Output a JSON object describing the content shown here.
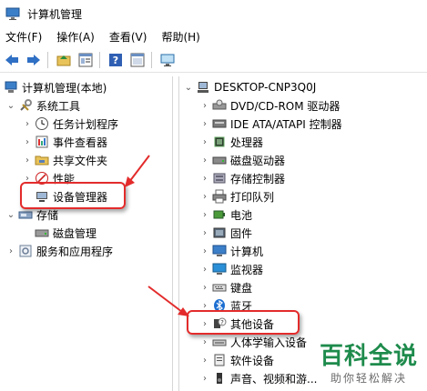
{
  "window": {
    "title": "计算机管理"
  },
  "menu": [
    "文件(F)",
    "操作(A)",
    "查看(V)",
    "帮助(H)"
  ],
  "toolbar": {
    "back_icon": "back-arrow-icon",
    "forward_icon": "forward-arrow-icon",
    "buttons": [
      "up-folder-icon",
      "properties-icon",
      "help-icon",
      "show-hide-icon",
      "monitor-icon"
    ]
  },
  "left_tree": {
    "root": "计算机管理(本地)",
    "system_tools": "系统工具",
    "task_scheduler": "任务计划程序",
    "event_viewer": "事件查看器",
    "shared_folders": "共享文件夹",
    "performance": "性能",
    "device_manager": "设备管理器",
    "storage": "存储",
    "disk_management": "磁盘管理",
    "services_apps": "服务和应用程序"
  },
  "right_tree": {
    "computer": "DESKTOP-CNP3Q0J",
    "items": [
      "DVD/CD-ROM 驱动器",
      "IDE ATA/ATAPI 控制器",
      "处理器",
      "磁盘驱动器",
      "存储控制器",
      "打印队列",
      "电池",
      "固件",
      "计算机",
      "监视器",
      "键盘",
      "蓝牙",
      "其他设备",
      "人体学输入设备",
      "软件设备",
      "声音、视频和游..."
    ]
  },
  "watermark": {
    "big": "百科全说",
    "small": "助你轻松解决"
  },
  "colors": {
    "highlight": "#e32b2b",
    "watermark": "#1e8b4c"
  }
}
